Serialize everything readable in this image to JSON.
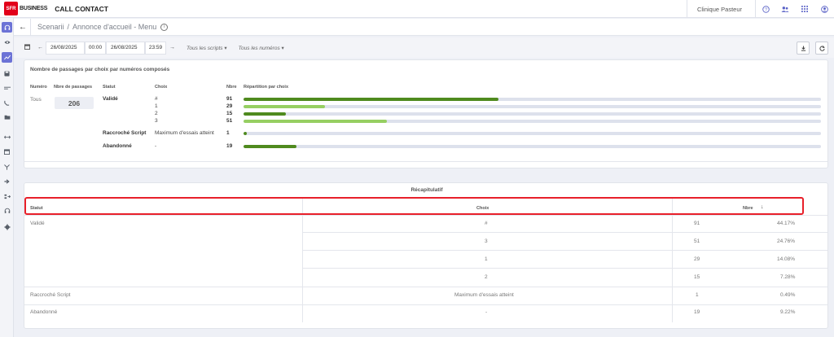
{
  "topbar": {
    "logo_text": "SFR",
    "brand": "BUSINESS",
    "product": "CALL CONTACT",
    "organization": "Clinique Pasteur",
    "icons": [
      "help-icon",
      "team-icon",
      "apps-grid-icon",
      "account-icon"
    ]
  },
  "sidebar": {
    "icons": [
      "headset-icon",
      "eye-icon",
      "chart-line-icon",
      "save-icon",
      "wave-icon",
      "phone-call-icon",
      "folder-icon",
      "transfer-icon",
      "calendar-icon",
      "filter-icon",
      "forward-icon",
      "queue-icon",
      "support-icon",
      "settings-icon"
    ]
  },
  "header": {
    "breadcrumb_parent": "Scenarii",
    "breadcrumb_separator": "/",
    "breadcrumb_current": "Annonce d'accueil - Menu",
    "info_symbol": "i"
  },
  "filters": {
    "start_date": "26/08/2025",
    "start_time": "00:00",
    "end_date": "26/08/2025",
    "end_time": "23:59",
    "scripts_dropdown": "Tous les scripts",
    "numbers_dropdown": "Tous les numéros"
  },
  "passages": {
    "title": "Nombre de passages par choix par numéros composés",
    "headers": {
      "numero": "Numéro",
      "nbre_passages": "Nbre de passages",
      "statut": "Statut",
      "choix": "Choix",
      "nbre": "Nbre",
      "repartition": "Répartition par choix"
    },
    "numero": "Tous",
    "total": "206",
    "max_value": 206,
    "groups": [
      {
        "status": "Validé",
        "rows": [
          {
            "choice": "#",
            "count": "91",
            "value": 91,
            "color": "#4f8a1e"
          },
          {
            "choice": "1",
            "count": "29",
            "value": 29,
            "color": "#96cf62"
          },
          {
            "choice": "2",
            "count": "15",
            "value": 15,
            "color": "#4f8a1e"
          },
          {
            "choice": "3",
            "count": "51",
            "value": 51,
            "color": "#96cf62"
          }
        ]
      },
      {
        "status": "Raccroché Script",
        "rows": [
          {
            "choice": "Maximum d'essais atteint",
            "count": "1",
            "value": 1,
            "color": "#4f8a1e"
          }
        ]
      },
      {
        "status": "Abandonné",
        "rows": [
          {
            "choice": "-",
            "count": "19",
            "value": 19,
            "color": "#4f8a1e"
          }
        ]
      }
    ]
  },
  "recap": {
    "title": "Récapitulatif",
    "headers": {
      "statut": "Statut",
      "choix": "Choix",
      "nbre": "Nbre",
      "sort_symbol": "↓"
    },
    "groups": [
      {
        "status": "Validé",
        "rows": [
          {
            "choice": "#",
            "count": "91",
            "percent": "44.17%"
          },
          {
            "choice": "3",
            "count": "51",
            "percent": "24.76%"
          },
          {
            "choice": "1",
            "count": "29",
            "percent": "14.08%"
          },
          {
            "choice": "2",
            "count": "15",
            "percent": "7.28%"
          }
        ]
      },
      {
        "status": "Raccroché Script",
        "rows": [
          {
            "choice": "Maximum d'essais atteint",
            "count": "1",
            "percent": "0.49%"
          }
        ]
      },
      {
        "status": "Abandonné",
        "rows": [
          {
            "choice": "-",
            "count": "19",
            "percent": "9.22%"
          }
        ]
      }
    ]
  }
}
